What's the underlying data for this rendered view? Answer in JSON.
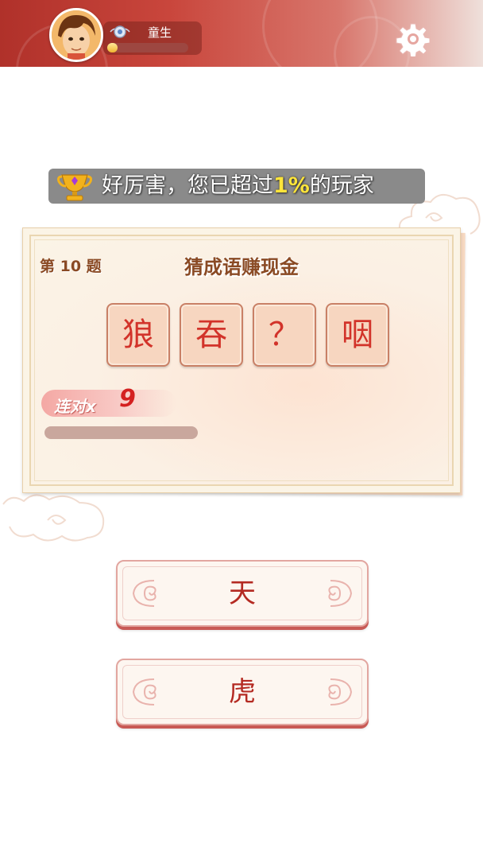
{
  "player": {
    "rank_title": "童生",
    "exp_progress": 0.13
  },
  "banner": {
    "text_before": "好厉害，您已超过",
    "highlight": "1%",
    "text_after": "的玩家"
  },
  "question": {
    "number_label": "第 10 题",
    "title": "猜成语赚现金",
    "tiles": [
      "狼",
      "吞",
      "？",
      "咽"
    ],
    "streak_label": "连对x",
    "streak_count": "9",
    "timer_remaining": 0.58
  },
  "answers": [
    "天",
    "虎"
  ],
  "icons": {
    "settings": "gear-icon",
    "trophy": "trophy-icon",
    "rank": "rank-badge-icon"
  },
  "colors": {
    "header_red": "#b0312a",
    "tile_text": "#d2332a",
    "answer_text": "#b42a22",
    "highlight_yellow": "#ffe53a"
  }
}
